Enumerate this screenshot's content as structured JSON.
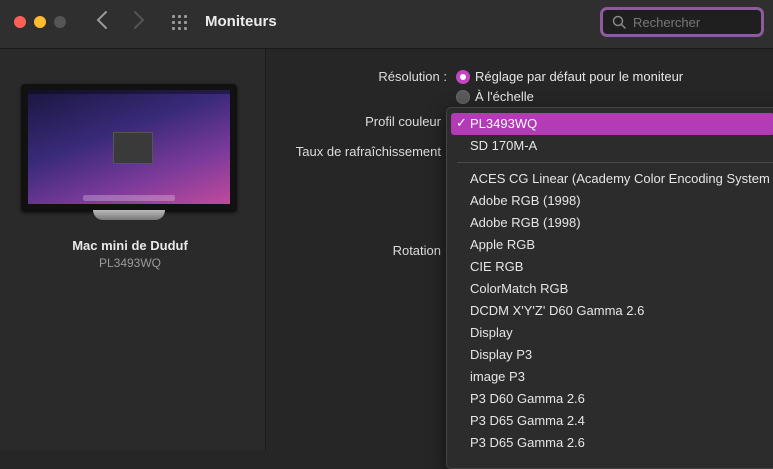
{
  "window": {
    "title": "Moniteurs",
    "search_placeholder": "Rechercher"
  },
  "sidebar": {
    "computer_name": "Mac mini de Duduf",
    "display_model": "PL3493WQ"
  },
  "settings": {
    "resolution_label": "Résolution :",
    "resolution_options": [
      {
        "label": "Réglage par défaut pour le moniteur",
        "selected": true
      },
      {
        "label": "À l'échelle",
        "selected": false
      }
    ],
    "color_profile_label": "Profil couleur",
    "refresh_rate_label": "Taux de rafraîchissement",
    "rotation_label": "Rotation"
  },
  "color_profile_menu": {
    "check_glyph": "✓",
    "items": [
      {
        "label": "PL3493WQ",
        "selected": true
      },
      {
        "label": "SD 170M-A",
        "selected": false
      },
      {
        "label": "ACES CG Linear (Academy Color Encoding System",
        "selected": false
      },
      {
        "label": "Adobe RGB (1998)",
        "selected": false
      },
      {
        "label": "Adobe RGB (1998)",
        "selected": false
      },
      {
        "label": "Apple RGB",
        "selected": false
      },
      {
        "label": "CIE RGB",
        "selected": false
      },
      {
        "label": "ColorMatch RGB",
        "selected": false
      },
      {
        "label": "DCDM X'Y'Z' D60 Gamma 2.6",
        "selected": false
      },
      {
        "label": "Display",
        "selected": false
      },
      {
        "label": "Display P3",
        "selected": false
      },
      {
        "label": "image P3",
        "selected": false
      },
      {
        "label": "P3 D60 Gamma 2.6",
        "selected": false
      },
      {
        "label": "P3 D65 Gamma 2.4",
        "selected": false
      },
      {
        "label": "P3 D65 Gamma 2.6",
        "selected": false
      }
    ]
  },
  "colors": {
    "accent": "#b33bb5",
    "search_focus_ring": "#8d5a9c"
  },
  "icons": [
    "back-chevron-icon",
    "forward-chevron-icon",
    "grid-icon",
    "search-icon",
    "checkmark-icon"
  ]
}
